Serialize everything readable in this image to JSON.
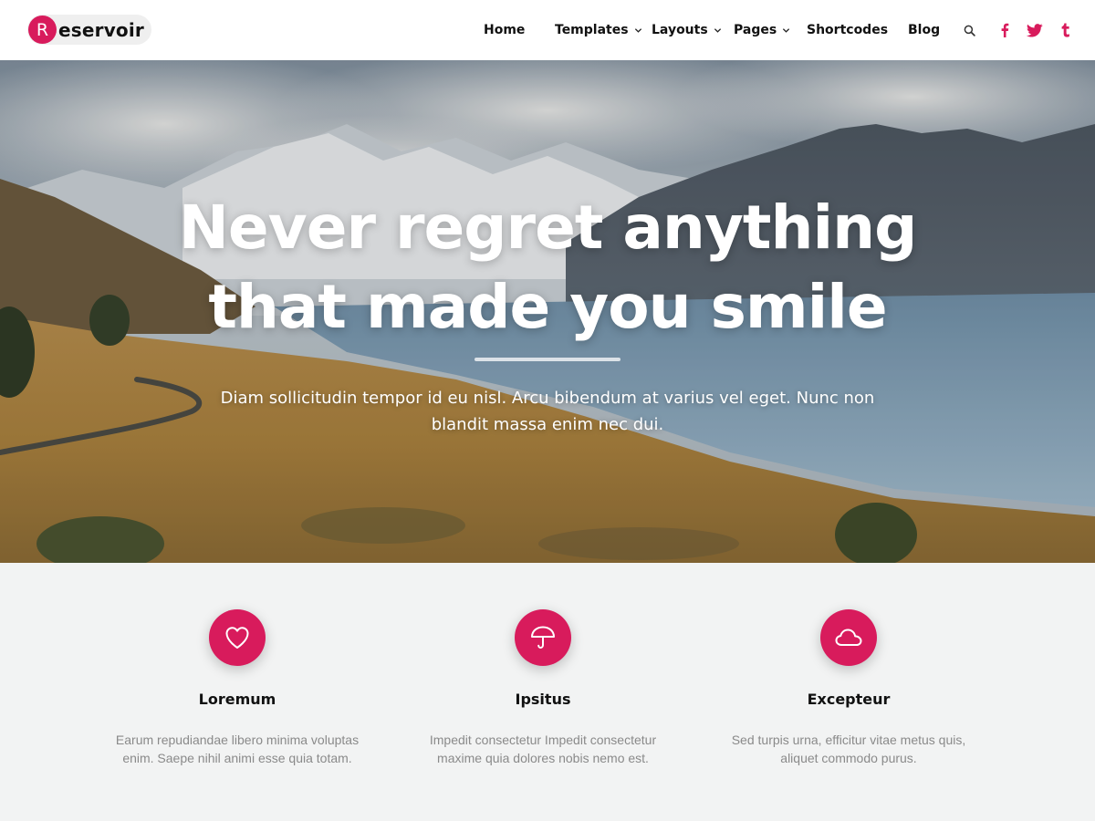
{
  "brand": {
    "logo_letter": "R",
    "logo_text": "eservoir",
    "accent_color": "#d81b5c"
  },
  "nav": {
    "items": [
      {
        "label": "Home",
        "has_dropdown": false
      },
      {
        "label": "Templates",
        "has_dropdown": true
      },
      {
        "label": "Layouts",
        "has_dropdown": true
      },
      {
        "label": "Pages",
        "has_dropdown": true
      },
      {
        "label": "Shortcodes",
        "has_dropdown": false
      },
      {
        "label": "Blog",
        "has_dropdown": false
      }
    ],
    "icons": [
      "search-icon",
      "facebook-icon",
      "twitter-icon",
      "tumblr-icon"
    ]
  },
  "hero": {
    "title_line1": "Never regret anything",
    "title_line2": "that made you smile",
    "subtitle": "Diam sollicitudin tempor id eu nisl. Arcu bibendum at varius vel eget. Nunc non blandit massa enim nec dui."
  },
  "features": [
    {
      "icon": "heart-icon",
      "title": "Loremum",
      "text": "Earum repudiandae libero minima voluptas enim. Saepe nihil animi esse quia totam."
    },
    {
      "icon": "umbrella-icon",
      "title": "Ipsitus",
      "text": "Impedit consectetur Impedit consectetur maxime quia dolores nobis nemo est."
    },
    {
      "icon": "cloud-icon",
      "title": "Excepteur",
      "text": "Sed turpis urna, efficitur vitae metus quis, aliquet commodo purus."
    }
  ]
}
